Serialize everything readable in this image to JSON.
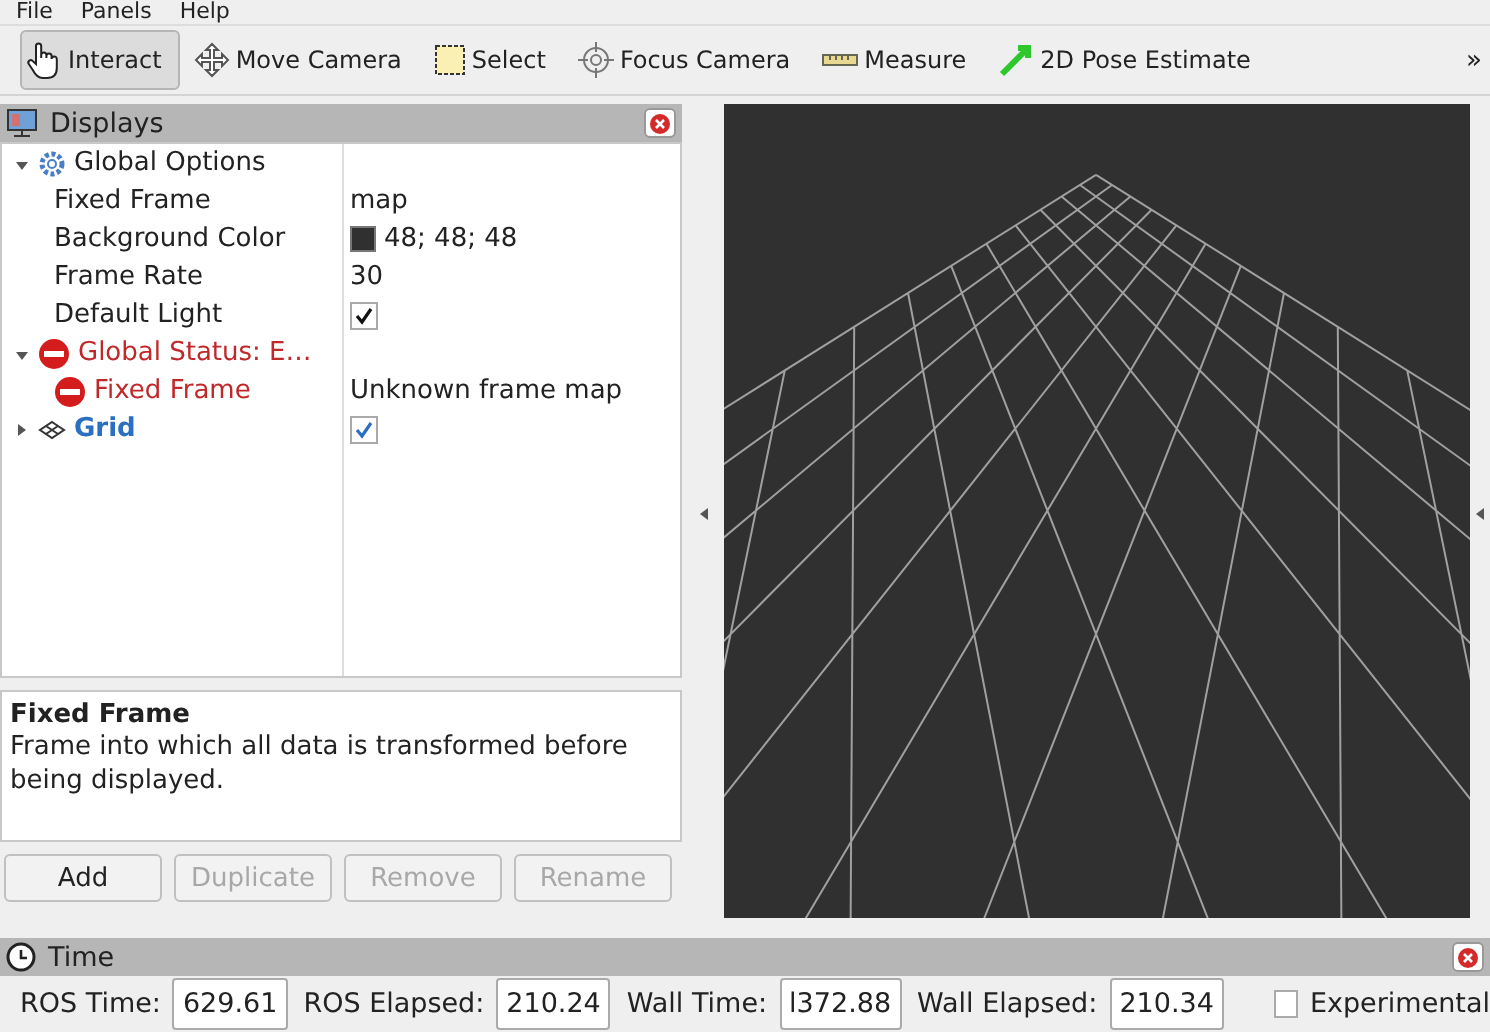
{
  "menu": [
    "File",
    "Panels",
    "Help"
  ],
  "toolbar": [
    {
      "label": "Interact",
      "selected": true
    },
    {
      "label": "Move Camera",
      "selected": false
    },
    {
      "label": "Select",
      "selected": false
    },
    {
      "label": "Focus Camera",
      "selected": false
    },
    {
      "label": "Measure",
      "selected": false
    },
    {
      "label": "2D Pose Estimate",
      "selected": false
    }
  ],
  "toolbar_overflow": "»",
  "displays": {
    "title": "Displays",
    "tree": [
      {
        "label": "Global Options",
        "kind": "group",
        "expanded": true,
        "children": [
          {
            "label": "Fixed Frame",
            "kind": "text",
            "value": "map"
          },
          {
            "label": "Background Color",
            "kind": "color",
            "value": "48; 48; 48",
            "color": "#303030"
          },
          {
            "label": "Frame Rate",
            "kind": "text",
            "value": "30"
          },
          {
            "label": "Default Light",
            "kind": "checkbox",
            "checked": true
          }
        ]
      },
      {
        "label": "Global Status: E…",
        "kind": "status",
        "error": true,
        "expanded": true,
        "children": [
          {
            "label": "Fixed Frame",
            "kind": "status",
            "error": true,
            "value": "Unknown frame map"
          }
        ]
      },
      {
        "label": "Grid",
        "kind": "display",
        "expanded": false,
        "checked": true
      }
    ],
    "description": {
      "title": "Fixed Frame",
      "text": "Frame into which all data is transformed before being displayed."
    },
    "buttons": [
      {
        "label": "Add",
        "disabled": false
      },
      {
        "label": "Duplicate",
        "disabled": true
      },
      {
        "label": "Remove",
        "disabled": true
      },
      {
        "label": "Rename",
        "disabled": true
      }
    ]
  },
  "time": {
    "title": "Time",
    "fields": [
      {
        "label": "ROS Time:",
        "value": "629.61"
      },
      {
        "label": "ROS Elapsed:",
        "value": "210.24"
      },
      {
        "label": "Wall Time:",
        "value": "l372.88"
      },
      {
        "label": "Wall Elapsed:",
        "value": "210.34"
      }
    ],
    "experimental": {
      "label": "Experimental",
      "checked": false
    }
  }
}
